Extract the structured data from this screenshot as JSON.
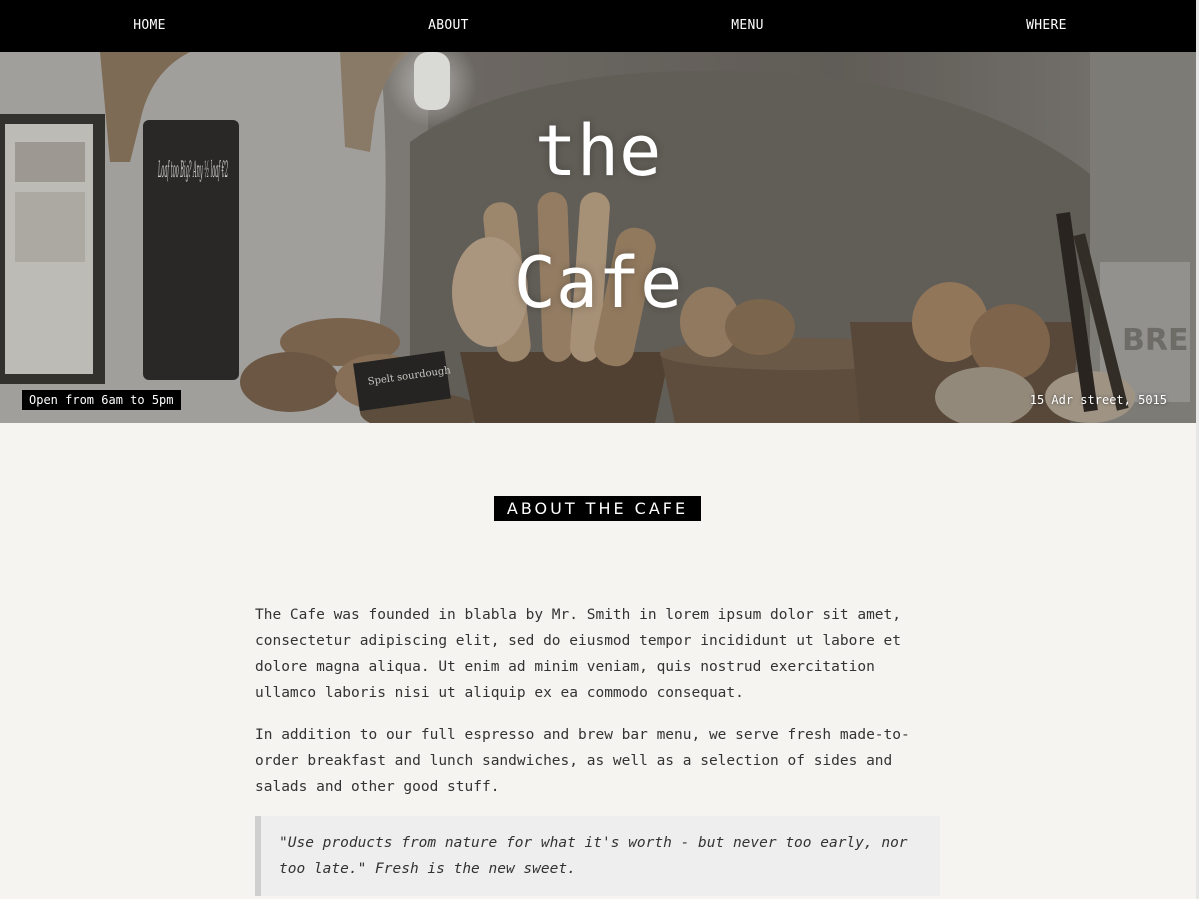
{
  "nav": {
    "items": [
      "HOME",
      "ABOUT",
      "MENU",
      "WHERE"
    ]
  },
  "hero": {
    "title_line1": "the",
    "title_line2": "Cafe",
    "hours": "Open from 6am to 5pm",
    "address": "15 Adr street, 5015",
    "chalkboard_text": "Loaf too Big? Any ½ loaf €2",
    "sign_text": "Spelt sourdough",
    "wall_letters": "BRE"
  },
  "about": {
    "heading": "ABOUT THE CAFE",
    "paragraph1": "The Cafe was founded in blabla by Mr. Smith in lorem ipsum dolor sit amet, consectetur adipiscing elit, sed do eiusmod tempor incididunt ut labore et dolore magna aliqua. Ut enim ad minim veniam, quis nostrud exercitation ullamco laboris nisi ut aliquip ex ea commodo consequat.",
    "paragraph2": "In addition to our full espresso and brew bar menu, we serve fresh made-to-order breakfast and lunch sandwiches, as well as a selection of sides and salads and other good stuff.",
    "quote": "\"Use products from nature for what it's worth - but never too early, nor too late.\" Fresh is the new sweet."
  },
  "colors": {
    "nav_bg": "#000000",
    "page_bg": "#f5f4f0",
    "heading_bg": "#000000",
    "quote_bg": "#eeeeee"
  }
}
